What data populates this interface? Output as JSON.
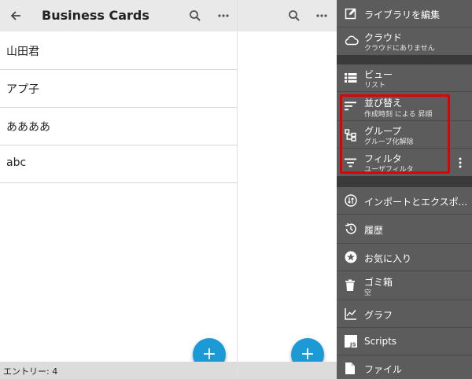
{
  "left": {
    "toolbar": {
      "title": "Business Cards"
    },
    "list": [
      "山田君",
      "アプ子",
      "ああああ",
      "abc"
    ],
    "footer": "エントリー: 4",
    "fab": "+"
  },
  "middle": {
    "fab": "+"
  },
  "drawer": {
    "items": [
      {
        "label": "ライブラリを編集",
        "icon": "edit-icon"
      },
      {
        "label": "クラウド",
        "sub": "クラウドにありません",
        "icon": "cloud-icon"
      },
      {
        "label": "ビュー",
        "sub": "リスト",
        "icon": "list-icon"
      },
      {
        "label": "並び替え",
        "sub": "作成時刻 による 昇順",
        "icon": "sort-icon"
      },
      {
        "label": "グループ",
        "sub": "グループ化解除",
        "icon": "group-icon"
      },
      {
        "label": "フィルタ",
        "sub": "ユーザフィルタ",
        "icon": "filter-icon"
      },
      {
        "label": "インポートとエクスポ...",
        "icon": "import-export-icon"
      },
      {
        "label": "履歴",
        "icon": "history-icon"
      },
      {
        "label": "お気に入り",
        "icon": "star-icon"
      },
      {
        "label": "ゴミ箱",
        "sub": "空",
        "icon": "trash-icon"
      },
      {
        "label": "グラフ",
        "icon": "chart-icon"
      },
      {
        "label": "Scripts",
        "icon": "js-icon"
      },
      {
        "label": "ファイル",
        "icon": "file-icon"
      }
    ]
  },
  "colors": {
    "fab": "#1b9ad6",
    "drawer": "#5c5c5c",
    "highlight": "#e10000",
    "toolbar": "#e9e9e9"
  }
}
